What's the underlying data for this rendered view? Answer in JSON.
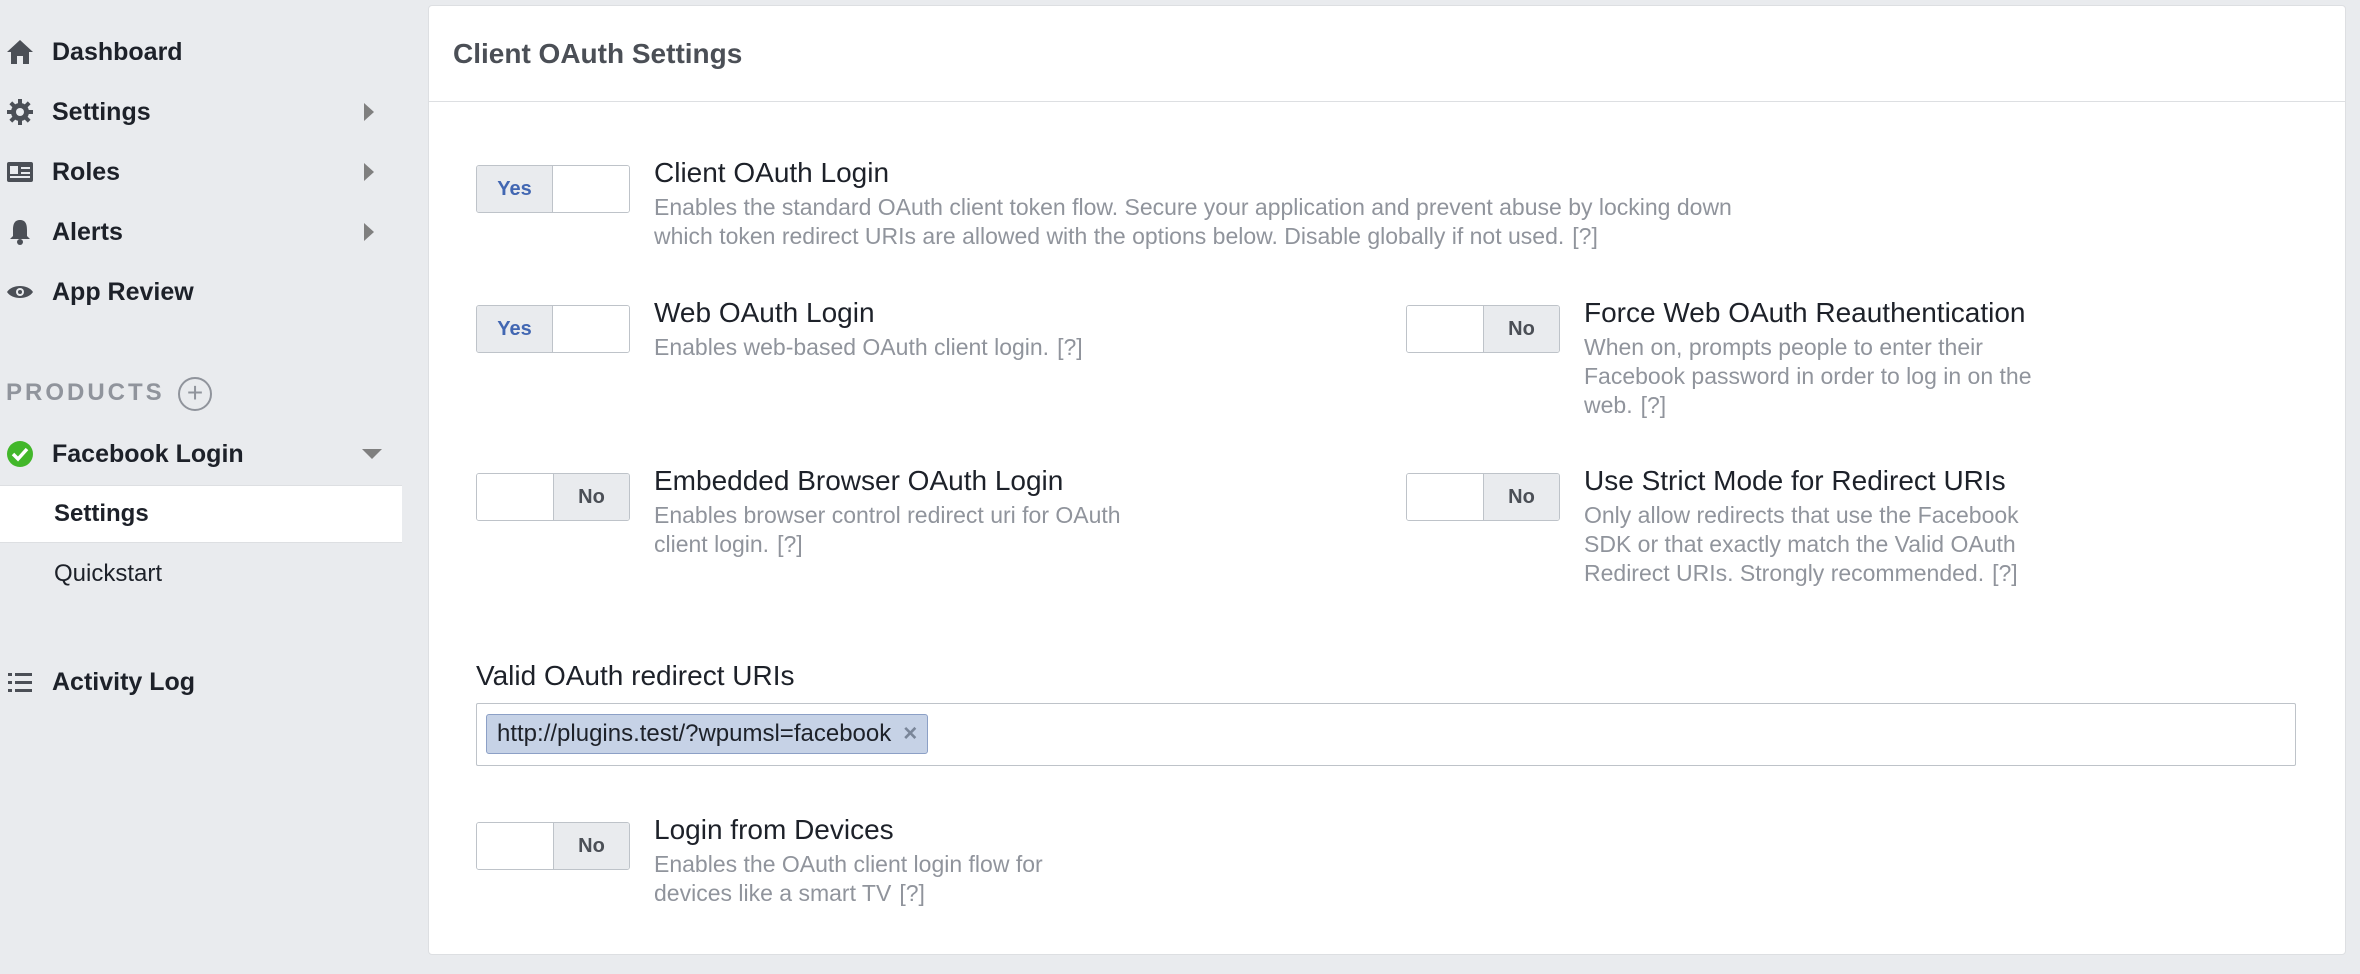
{
  "sidebar": {
    "nav": [
      {
        "label": "Dashboard",
        "icon": "home-icon"
      },
      {
        "label": "Settings",
        "icon": "gear-icon"
      },
      {
        "label": "Roles",
        "icon": "id-card-icon"
      },
      {
        "label": "Alerts",
        "icon": "bell-icon"
      },
      {
        "label": "App Review",
        "icon": "eye-icon"
      }
    ],
    "products_label": "PRODUCTS",
    "product": {
      "label": "Facebook Login",
      "status_color": "#42b72a"
    },
    "sub_items": [
      {
        "label": "Settings",
        "active": true
      },
      {
        "label": "Quickstart",
        "active": false
      }
    ],
    "activity_log": {
      "label": "Activity Log",
      "icon": "list-icon"
    }
  },
  "card": {
    "title": "Client OAuth Settings",
    "settings": {
      "client_oauth": {
        "title": "Client OAuth Login",
        "desc": "Enables the standard OAuth client token flow. Secure your application and prevent abuse by locking down which token redirect URIs are allowed with the options below. Disable globally if not used.",
        "value": "Yes"
      },
      "web_oauth": {
        "title": "Web OAuth Login",
        "desc": "Enables web-based OAuth client login.",
        "value": "Yes"
      },
      "force_reauth": {
        "title": "Force Web OAuth Reauthentication",
        "desc": "When on, prompts people to enter their Facebook password in order to log in on the web.",
        "value": "No"
      },
      "embedded_browser": {
        "title": "Embedded Browser OAuth Login",
        "desc": "Enables browser control redirect uri for OAuth client login.",
        "value": "No"
      },
      "strict_mode": {
        "title": "Use Strict Mode for Redirect URIs",
        "desc": "Only allow redirects that use the Facebook SDK or that exactly match the Valid OAuth Redirect URIs. Strongly recommended.",
        "value": "No"
      },
      "login_devices": {
        "title": "Login from Devices",
        "desc": "Enables the OAuth client login flow for devices like a smart TV",
        "value": "No"
      }
    },
    "help_label": "[?]",
    "redirect_label": "Valid OAuth redirect URIs",
    "redirect_uris": [
      "http://plugins.test/?wpumsl=facebook"
    ],
    "tag_remove": "×"
  },
  "colors": {
    "accent": "#4267b2",
    "muted": "#90949c",
    "background": "#e9ebee"
  }
}
